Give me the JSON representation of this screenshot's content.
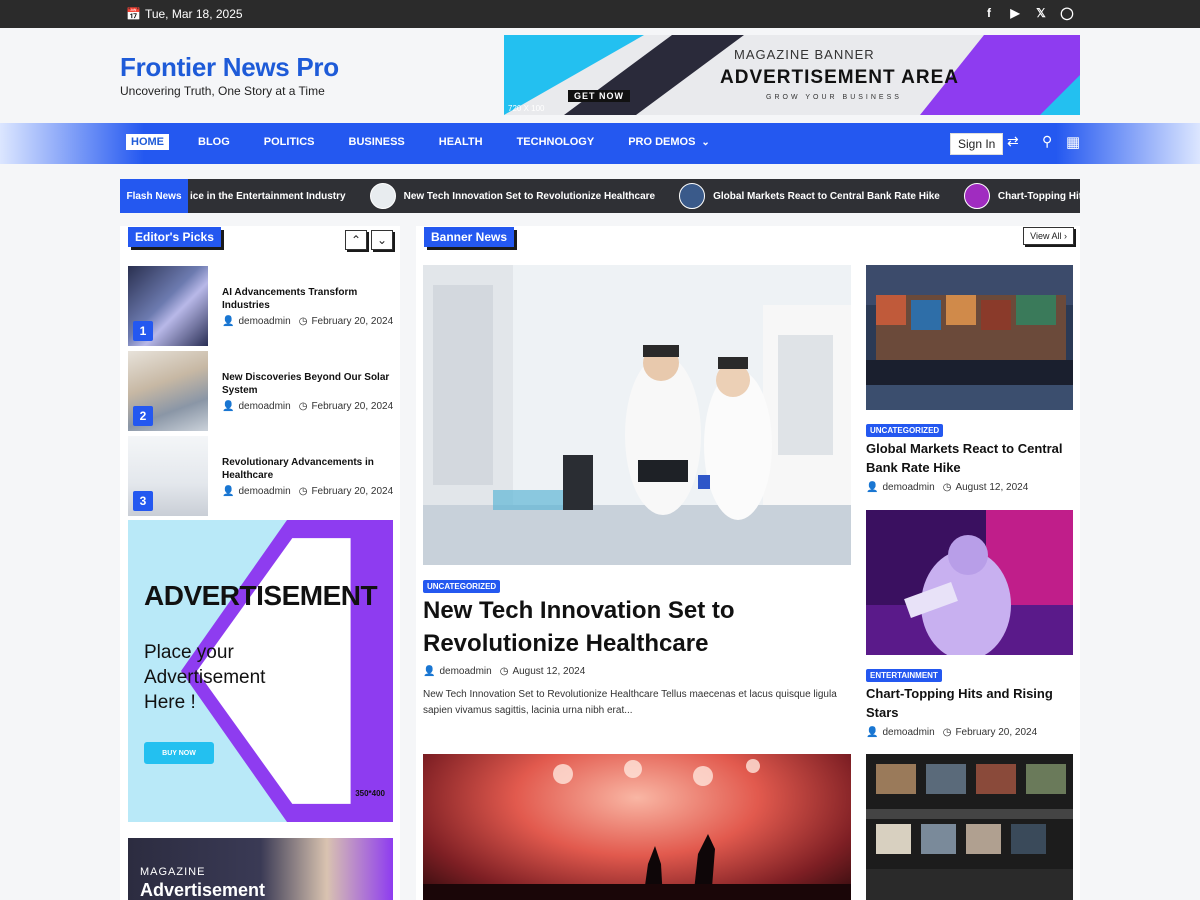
{
  "topbar": {
    "date": "Tue, Mar 18, 2025",
    "social_icons": [
      "facebook-icon",
      "youtube-icon",
      "x-icon",
      "instagram-icon"
    ]
  },
  "header": {
    "site_title": "Frontier News Pro",
    "tagline": "Uncovering Truth, One Story at a Time",
    "ad": {
      "sub": "MAGAZINE BANNER",
      "main": "ADVERTISEMENT AREA",
      "small": "GROW YOUR BUSINESS",
      "cta": "GET NOW",
      "size": "720 X 100"
    }
  },
  "nav": {
    "items": [
      {
        "label": "HOME"
      },
      {
        "label": "BLOG"
      },
      {
        "label": "POLITICS"
      },
      {
        "label": "BUSINESS"
      },
      {
        "label": "HEALTH"
      },
      {
        "label": "TECHNOLOGY"
      },
      {
        "label": "PRO DEMOS"
      }
    ],
    "signin": "Sign In"
  },
  "flash": {
    "label": "Flash News",
    "items": [
      "ice in the Entertainment Industry",
      "New Tech Innovation Set to Revolutionize Healthcare",
      "Global Markets React to Central Bank Rate Hike",
      "Chart-Topping Hits and R"
    ]
  },
  "editors_picks": {
    "title": "Editor's Picks",
    "items": [
      {
        "num": "1",
        "title": "AI Advancements Transform Industries",
        "author": "demoadmin",
        "date": "February 20, 2024"
      },
      {
        "num": "2",
        "title": "New Discoveries Beyond Our Solar System",
        "author": "demoadmin",
        "date": "February 20, 2024"
      },
      {
        "num": "3",
        "title": "Revolutionary Advancements in Healthcare",
        "author": "demoadmin",
        "date": "February 20, 2024"
      }
    ],
    "ad": {
      "big": "ADVERTISEMENT",
      "text": "Place your Advertisement Here !",
      "button": "BUY NOW",
      "size": "350*400"
    },
    "ad2": {
      "line1": "MAGAZINE",
      "line2": "Advertisement"
    }
  },
  "banner_news": {
    "title": "Banner News",
    "view_all": "View All",
    "main": {
      "category": "UNCATEGORIZED",
      "title": "New Tech Innovation Set to Revolutionize Healthcare",
      "author": "demoadmin",
      "date": "August 12, 2024",
      "excerpt": "New Tech Innovation Set to Revolutionize Healthcare Tellus maecenas et lacus quisque ligula sapien vivamus sagittis, lacinia urna nibh erat..."
    },
    "side": [
      {
        "category": "UNCATEGORIZED",
        "title": "Global Markets React to Central Bank Rate Hike",
        "author": "demoadmin",
        "date": "August 12, 2024"
      },
      {
        "category": "ENTERTAINMENT",
        "title": "Chart-Topping Hits and Rising Stars",
        "author": "demoadmin",
        "date": "February 20, 2024"
      }
    ]
  },
  "colors": {
    "accent": "#2458f0",
    "dark": "#2b2b2b",
    "ad_purple": "#8e3cf0",
    "ad_cyan": "#23c0f0"
  }
}
